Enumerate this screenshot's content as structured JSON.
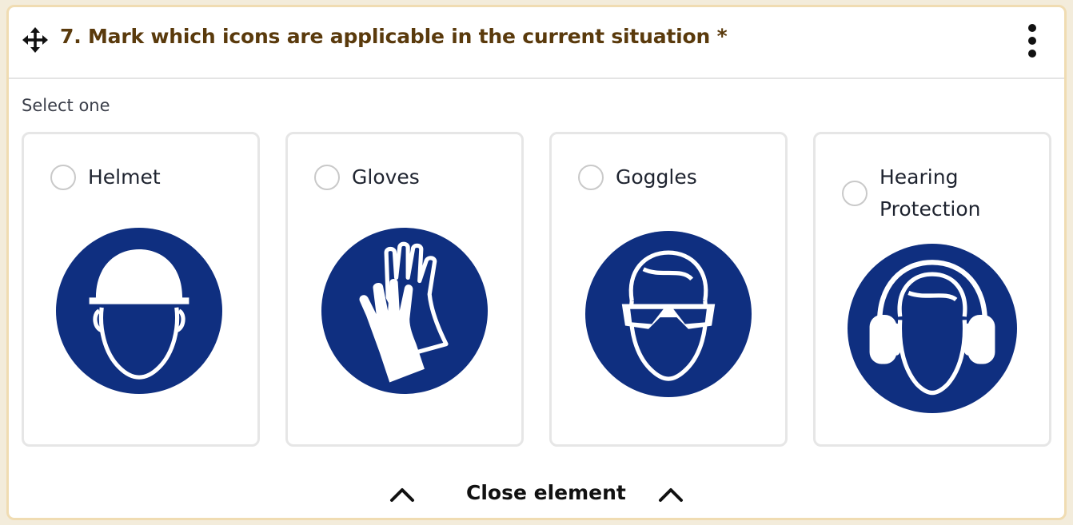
{
  "question": {
    "title": "7. Mark which icons are applicable in the current situation *",
    "subtitle": "Select one"
  },
  "options": [
    {
      "label": "Helmet",
      "icon": "helmet-icon",
      "selected": false
    },
    {
      "label": "Gloves",
      "icon": "gloves-icon",
      "selected": false
    },
    {
      "label": "Goggles",
      "icon": "goggles-icon",
      "selected": false
    },
    {
      "label": "Hearing Protection",
      "icon": "hearing-protection-icon",
      "selected": false
    }
  ],
  "footer": {
    "close_label": "Close element"
  },
  "colors": {
    "sign_blue": "#0f2f80",
    "title_brown": "#5a3a0c",
    "frame_border": "#f0dcb2",
    "card_border": "#e6e6e6"
  }
}
